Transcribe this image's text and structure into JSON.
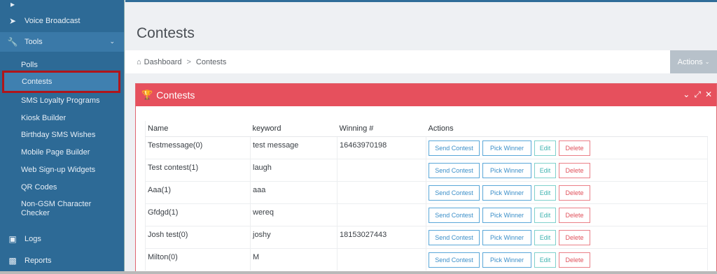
{
  "sidebar": {
    "top_item": {
      "icon": "megaphone-icon"
    },
    "voice_broadcast": {
      "label": "Voice Broadcast",
      "icon": "bullhorn-icon"
    },
    "tools": {
      "label": "Tools",
      "icon": "wrench-icon"
    },
    "sub_items": [
      "Polls",
      "Contests",
      "SMS Loyalty Programs",
      "Kiosk Builder",
      "Birthday SMS Wishes",
      "Mobile Page Builder",
      "Web Sign-up Widgets",
      "QR Codes",
      "Non-GSM Character Checker"
    ],
    "logs": {
      "label": "Logs",
      "icon": "file-icon"
    },
    "reports": {
      "label": "Reports",
      "icon": "bar-chart-icon"
    }
  },
  "page": {
    "title": "Contests",
    "breadcrumb": {
      "home": "Dashboard",
      "current": "Contests"
    },
    "actions_label": "Actions"
  },
  "panel": {
    "title": "Contests",
    "icon": "trophy-icon"
  },
  "table": {
    "headers": [
      "Name",
      "keyword",
      "Winning #",
      "Actions"
    ],
    "rows": [
      {
        "name": "Testmessage(0)",
        "keyword": "test message",
        "winning": "16463970198"
      },
      {
        "name": "Test contest(1)",
        "keyword": "laugh",
        "winning": ""
      },
      {
        "name": "Aaa(1)",
        "keyword": "aaa",
        "winning": ""
      },
      {
        "name": "Gfdgd(1)",
        "keyword": "wereq",
        "winning": ""
      },
      {
        "name": "Josh test(0)",
        "keyword": "joshy",
        "winning": "18153027443"
      },
      {
        "name": "Milton(0)",
        "keyword": "M",
        "winning": ""
      }
    ],
    "buttons": {
      "send": "Send Contest",
      "pick": "Pick Winner",
      "edit": "Edit",
      "delete": "Delete"
    }
  },
  "colors": {
    "sidebar": "#2d6a96",
    "panel_header": "#e6505d",
    "highlight_box": "#b0151a"
  }
}
